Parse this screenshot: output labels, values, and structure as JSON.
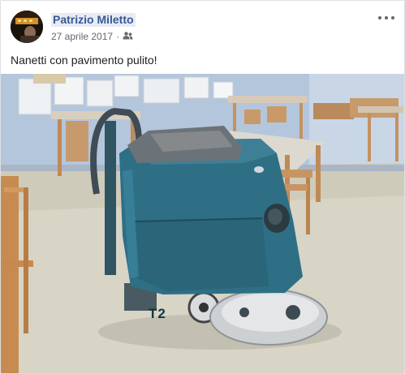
{
  "post": {
    "author": "Patrizio Miletto",
    "date": "27 aprile 2017",
    "separator": "·",
    "audience_icon": "friends-icon",
    "more_icon": "more-options-icon",
    "text": "Nanetti con pavimento pulito!",
    "photo": {
      "subject": "floor-scrubber machine in classroom",
      "model_label": "T2"
    }
  }
}
